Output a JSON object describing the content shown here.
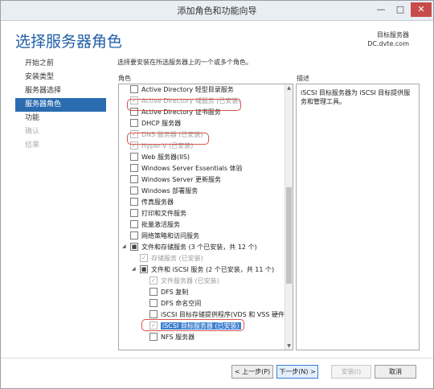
{
  "window": {
    "title": "添加角色和功能向导",
    "controls": {
      "minimize": "—",
      "maximize": "□",
      "close": "✕"
    }
  },
  "header": {
    "page_title": "选择服务器角色",
    "destination_label": "目标服务器",
    "destination_value": "DC.dvte.com"
  },
  "nav": {
    "items": [
      {
        "label": "开始之前",
        "state": "normal"
      },
      {
        "label": "安装类型",
        "state": "normal"
      },
      {
        "label": "服务器选择",
        "state": "normal"
      },
      {
        "label": "服务器角色",
        "state": "active"
      },
      {
        "label": "功能",
        "state": "normal"
      },
      {
        "label": "确认",
        "state": "disabled"
      },
      {
        "label": "结果",
        "state": "disabled"
      }
    ]
  },
  "main": {
    "instruction": "选择要安装在所选服务器上的一个或多个角色。",
    "roles_header": "角色",
    "description_header": "描述",
    "description_text": "iSCSI 目标服务器为 iSCSI 目标提供服务和管理工具。"
  },
  "roles": [
    {
      "label": "Active Directory 轻型目录服务",
      "checked": false,
      "installed": false,
      "level": 0
    },
    {
      "label": "Active Directory 域服务 (已安装)",
      "checked": true,
      "installed": true,
      "level": 0
    },
    {
      "label": "Active Directory 证书服务",
      "checked": false,
      "installed": false,
      "level": 0
    },
    {
      "label": "DHCP 服务器",
      "checked": false,
      "installed": false,
      "level": 0
    },
    {
      "label": "DNS 服务器 (已安装)",
      "checked": true,
      "installed": true,
      "level": 0
    },
    {
      "label": "Hyper-V (已安装)",
      "checked": true,
      "installed": true,
      "level": 0
    },
    {
      "label": "Web 服务器(IIS)",
      "checked": false,
      "installed": false,
      "level": 0
    },
    {
      "label": "Windows Server Essentials 体验",
      "checked": false,
      "installed": false,
      "level": 0
    },
    {
      "label": "Windows Server 更新服务",
      "checked": false,
      "installed": false,
      "level": 0
    },
    {
      "label": "Windows 部署服务",
      "checked": false,
      "installed": false,
      "level": 0
    },
    {
      "label": "传真服务器",
      "checked": false,
      "installed": false,
      "level": 0
    },
    {
      "label": "打印和文件服务",
      "checked": false,
      "installed": false,
      "level": 0
    },
    {
      "label": "批量激活服务",
      "checked": false,
      "installed": false,
      "level": 0
    },
    {
      "label": "网络策略和访问服务",
      "checked": false,
      "installed": false,
      "level": 0
    },
    {
      "label": "文件和存储服务 (3 个已安装，共 12 个)",
      "checked": "partial",
      "installed": false,
      "level": 0,
      "expanded": true
    },
    {
      "label": "存储服务 (已安装)",
      "checked": true,
      "installed": true,
      "level": 1
    },
    {
      "label": "文件和 iSCSI 服务 (2 个已安装，共 11 个)",
      "checked": "partial",
      "installed": false,
      "level": 1,
      "expanded": true
    },
    {
      "label": "文件服务器 (已安装)",
      "checked": true,
      "installed": true,
      "level": 2
    },
    {
      "label": "DFS 复制",
      "checked": false,
      "installed": false,
      "level": 2
    },
    {
      "label": "DFS 命名空间",
      "checked": false,
      "installed": false,
      "level": 2
    },
    {
      "label": "iSCSI 目标存储提供程序(VDS 和 VSS 硬件提",
      "checked": false,
      "installed": false,
      "level": 2
    },
    {
      "label": "iSCSI 目标服务器 (已安装)",
      "checked": true,
      "installed": true,
      "level": 2,
      "selected": true
    },
    {
      "label": "NFS 服务器",
      "checked": false,
      "installed": false,
      "level": 2
    }
  ],
  "scroll": {
    "up": "▲",
    "down": "▼"
  },
  "footer": {
    "prev": "< 上一步(P)",
    "next": "下一步(N) >",
    "install": "安装(I)",
    "cancel": "取消"
  },
  "colors": {
    "accent": "#2b6cb0",
    "annotation": "#d9534f",
    "selection": "#3e7fd0"
  }
}
